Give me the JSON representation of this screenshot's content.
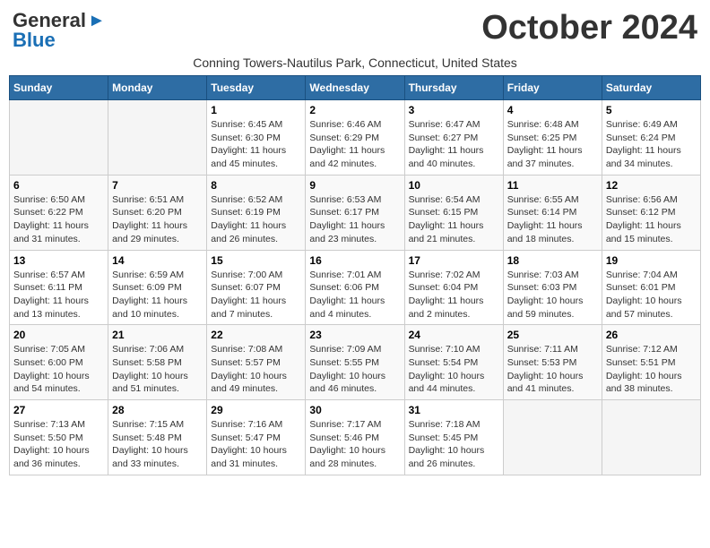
{
  "header": {
    "logo_line1": "General",
    "logo_line2": "Blue",
    "month": "October 2024",
    "subtitle": "Conning Towers-Nautilus Park, Connecticut, United States"
  },
  "days_of_week": [
    "Sunday",
    "Monday",
    "Tuesday",
    "Wednesday",
    "Thursday",
    "Friday",
    "Saturday"
  ],
  "weeks": [
    [
      {
        "num": "",
        "detail": ""
      },
      {
        "num": "",
        "detail": ""
      },
      {
        "num": "1",
        "detail": "Sunrise: 6:45 AM\nSunset: 6:30 PM\nDaylight: 11 hours and 45 minutes."
      },
      {
        "num": "2",
        "detail": "Sunrise: 6:46 AM\nSunset: 6:29 PM\nDaylight: 11 hours and 42 minutes."
      },
      {
        "num": "3",
        "detail": "Sunrise: 6:47 AM\nSunset: 6:27 PM\nDaylight: 11 hours and 40 minutes."
      },
      {
        "num": "4",
        "detail": "Sunrise: 6:48 AM\nSunset: 6:25 PM\nDaylight: 11 hours and 37 minutes."
      },
      {
        "num": "5",
        "detail": "Sunrise: 6:49 AM\nSunset: 6:24 PM\nDaylight: 11 hours and 34 minutes."
      }
    ],
    [
      {
        "num": "6",
        "detail": "Sunrise: 6:50 AM\nSunset: 6:22 PM\nDaylight: 11 hours and 31 minutes."
      },
      {
        "num": "7",
        "detail": "Sunrise: 6:51 AM\nSunset: 6:20 PM\nDaylight: 11 hours and 29 minutes."
      },
      {
        "num": "8",
        "detail": "Sunrise: 6:52 AM\nSunset: 6:19 PM\nDaylight: 11 hours and 26 minutes."
      },
      {
        "num": "9",
        "detail": "Sunrise: 6:53 AM\nSunset: 6:17 PM\nDaylight: 11 hours and 23 minutes."
      },
      {
        "num": "10",
        "detail": "Sunrise: 6:54 AM\nSunset: 6:15 PM\nDaylight: 11 hours and 21 minutes."
      },
      {
        "num": "11",
        "detail": "Sunrise: 6:55 AM\nSunset: 6:14 PM\nDaylight: 11 hours and 18 minutes."
      },
      {
        "num": "12",
        "detail": "Sunrise: 6:56 AM\nSunset: 6:12 PM\nDaylight: 11 hours and 15 minutes."
      }
    ],
    [
      {
        "num": "13",
        "detail": "Sunrise: 6:57 AM\nSunset: 6:11 PM\nDaylight: 11 hours and 13 minutes."
      },
      {
        "num": "14",
        "detail": "Sunrise: 6:59 AM\nSunset: 6:09 PM\nDaylight: 11 hours and 10 minutes."
      },
      {
        "num": "15",
        "detail": "Sunrise: 7:00 AM\nSunset: 6:07 PM\nDaylight: 11 hours and 7 minutes."
      },
      {
        "num": "16",
        "detail": "Sunrise: 7:01 AM\nSunset: 6:06 PM\nDaylight: 11 hours and 4 minutes."
      },
      {
        "num": "17",
        "detail": "Sunrise: 7:02 AM\nSunset: 6:04 PM\nDaylight: 11 hours and 2 minutes."
      },
      {
        "num": "18",
        "detail": "Sunrise: 7:03 AM\nSunset: 6:03 PM\nDaylight: 10 hours and 59 minutes."
      },
      {
        "num": "19",
        "detail": "Sunrise: 7:04 AM\nSunset: 6:01 PM\nDaylight: 10 hours and 57 minutes."
      }
    ],
    [
      {
        "num": "20",
        "detail": "Sunrise: 7:05 AM\nSunset: 6:00 PM\nDaylight: 10 hours and 54 minutes."
      },
      {
        "num": "21",
        "detail": "Sunrise: 7:06 AM\nSunset: 5:58 PM\nDaylight: 10 hours and 51 minutes."
      },
      {
        "num": "22",
        "detail": "Sunrise: 7:08 AM\nSunset: 5:57 PM\nDaylight: 10 hours and 49 minutes."
      },
      {
        "num": "23",
        "detail": "Sunrise: 7:09 AM\nSunset: 5:55 PM\nDaylight: 10 hours and 46 minutes."
      },
      {
        "num": "24",
        "detail": "Sunrise: 7:10 AM\nSunset: 5:54 PM\nDaylight: 10 hours and 44 minutes."
      },
      {
        "num": "25",
        "detail": "Sunrise: 7:11 AM\nSunset: 5:53 PM\nDaylight: 10 hours and 41 minutes."
      },
      {
        "num": "26",
        "detail": "Sunrise: 7:12 AM\nSunset: 5:51 PM\nDaylight: 10 hours and 38 minutes."
      }
    ],
    [
      {
        "num": "27",
        "detail": "Sunrise: 7:13 AM\nSunset: 5:50 PM\nDaylight: 10 hours and 36 minutes."
      },
      {
        "num": "28",
        "detail": "Sunrise: 7:15 AM\nSunset: 5:48 PM\nDaylight: 10 hours and 33 minutes."
      },
      {
        "num": "29",
        "detail": "Sunrise: 7:16 AM\nSunset: 5:47 PM\nDaylight: 10 hours and 31 minutes."
      },
      {
        "num": "30",
        "detail": "Sunrise: 7:17 AM\nSunset: 5:46 PM\nDaylight: 10 hours and 28 minutes."
      },
      {
        "num": "31",
        "detail": "Sunrise: 7:18 AM\nSunset: 5:45 PM\nDaylight: 10 hours and 26 minutes."
      },
      {
        "num": "",
        "detail": ""
      },
      {
        "num": "",
        "detail": ""
      }
    ]
  ]
}
